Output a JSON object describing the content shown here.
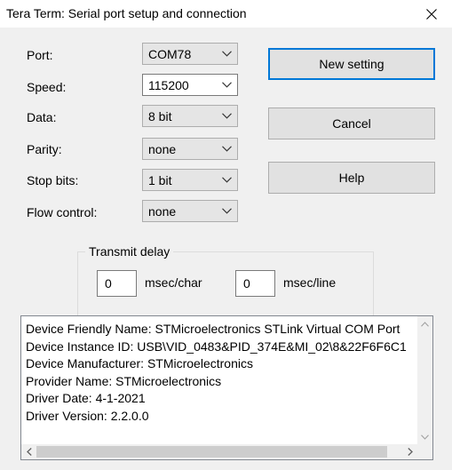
{
  "window": {
    "title": "Tera Term: Serial port setup and connection"
  },
  "form": {
    "port_label": "Port:",
    "port_value": "COM78",
    "speed_label": "Speed:",
    "speed_value": "115200",
    "data_label": "Data:",
    "data_value": "8 bit",
    "parity_label": "Parity:",
    "parity_value": "none",
    "stopbits_label": "Stop bits:",
    "stopbits_value": "1 bit",
    "flow_label": "Flow control:",
    "flow_value": "none"
  },
  "buttons": {
    "new_setting": "New setting",
    "cancel": "Cancel",
    "help": "Help"
  },
  "transmit_delay": {
    "title": "Transmit delay",
    "char_value": "0",
    "char_unit": "msec/char",
    "line_value": "0",
    "line_unit": "msec/line"
  },
  "device_info": {
    "lines": [
      "Device Friendly Name: STMicroelectronics STLink Virtual COM Port",
      "Device Instance ID: USB\\VID_0483&PID_374E&MI_02\\8&22F6F6C1",
      "Device Manufacturer: STMicroelectronics",
      "Provider Name: STMicroelectronics",
      "Driver Date: 4-1-2021",
      "Driver Version: 2.2.0.0"
    ]
  },
  "colors": {
    "dialog_bg": "#f0f0f0",
    "focus_border": "#0078d7",
    "button_bg": "#e1e1e1"
  }
}
